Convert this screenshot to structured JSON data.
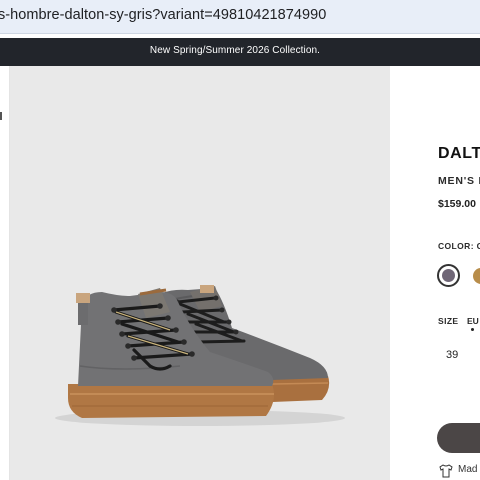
{
  "browser": {
    "url": "s-hombre-dalton-sy-gris?variant=49810421874990"
  },
  "announcement": {
    "text": "New Spring/Summer 2026 Collection."
  },
  "product": {
    "title": "DALTO",
    "subtitle": "MEN'S L",
    "price": "$159.00",
    "color_label": "COLOR: G",
    "swatches": [
      {
        "name": "grey",
        "color": "#6f6676",
        "selected": true
      },
      {
        "name": "tan",
        "color": "#b88d4a",
        "selected": false
      }
    ],
    "size_label": "SIZE",
    "size_unit": "EU",
    "size_value": "39",
    "made_text": "Mad"
  },
  "image": {
    "subject": "grey suede mid-top boots with gum sole and multicolor laces",
    "background": "#e9e9e9"
  }
}
